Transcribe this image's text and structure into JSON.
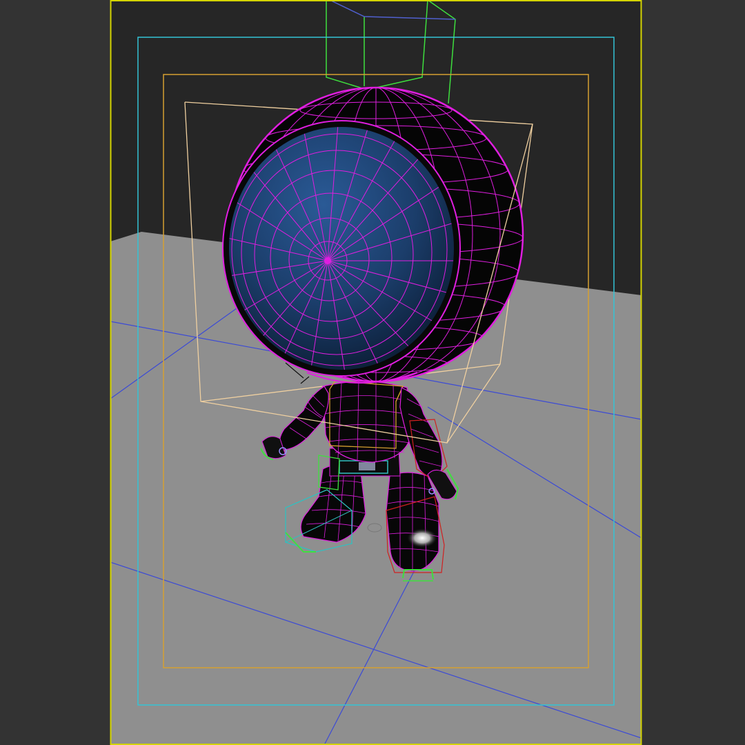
{
  "viewport": {
    "kind": "3d-perspective-viewport",
    "shading": "smooth-plus-wireframe",
    "colors": {
      "outside_area": "#333333",
      "backdrop": "#262626",
      "ground": "#8f8f8f",
      "grid_lines": "#3b4ad6",
      "safe_frame_outer": "#d4d400",
      "safe_frame_action": "#33c4d6",
      "safe_frame_title": "#d6a030",
      "selection_wire": "#e01ee0",
      "head_bbox": "#f0d0a0",
      "controls_green": "#3ee03e",
      "controls_cyan": "#30c0c0",
      "controls_red": "#d02020",
      "face_dark": "#0a1a30",
      "face_light": "#2a5a96",
      "body_fill": "#070707"
    },
    "icons": [
      "robot-character-model",
      "perspective-grid",
      "safe-frame",
      "bounding-box",
      "ik-control"
    ]
  }
}
